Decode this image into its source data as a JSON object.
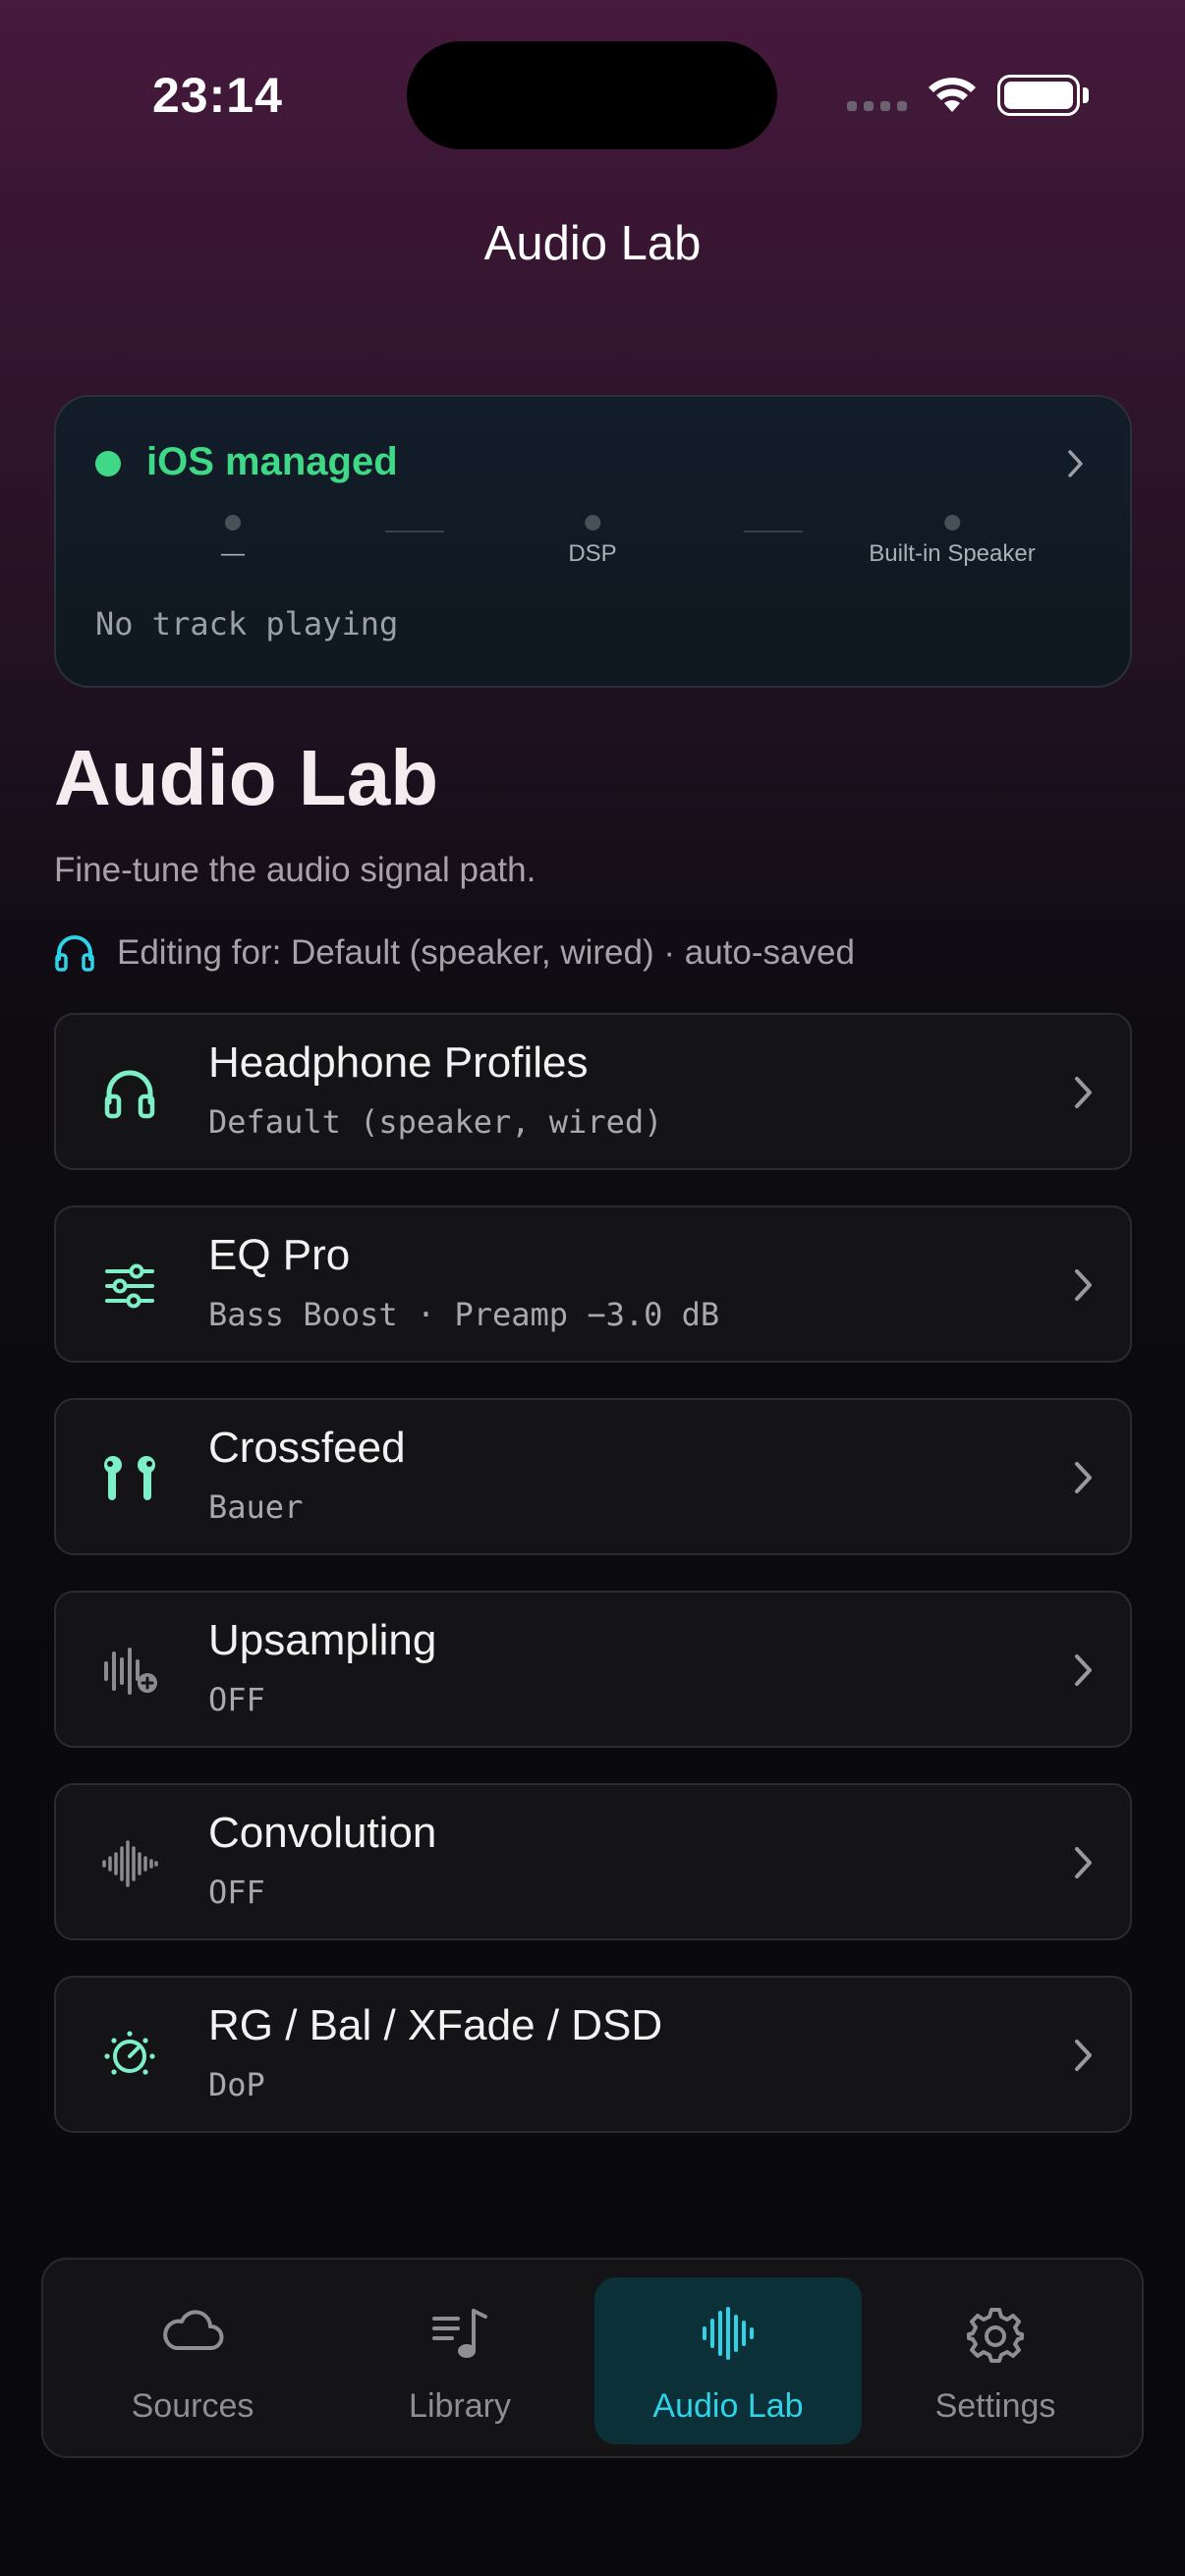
{
  "status_bar": {
    "time": "23:14"
  },
  "nav": {
    "title": "Audio Lab"
  },
  "status_card": {
    "state": "iOS managed",
    "state_color": "#3fd886",
    "chain": [
      "—",
      "DSP",
      "Built-in Speaker"
    ],
    "now_playing": "No track playing"
  },
  "header": {
    "title": "Audio Lab",
    "subtitle": "Fine-tune the audio signal path.",
    "editing": "Editing for: Default (speaker, wired) · auto-saved"
  },
  "items": [
    {
      "title": "Headphone Profiles",
      "value": "Default (speaker, wired)",
      "icon": "headphones-icon"
    },
    {
      "title": "EQ Pro",
      "value": "Bass Boost · Preamp −3.0 dB",
      "icon": "sliders-icon"
    },
    {
      "title": "Crossfeed",
      "value": "Bauer",
      "icon": "earbuds-icon"
    },
    {
      "title": "Upsampling",
      "value": "OFF",
      "icon": "waveform-plus-icon"
    },
    {
      "title": "Convolution",
      "value": "OFF",
      "icon": "waveform-icon"
    },
    {
      "title": "RG / Bal / XFade / DSD",
      "value": "DoP",
      "icon": "dial-icon"
    }
  ],
  "tabs": [
    {
      "label": "Sources",
      "icon": "cloud-icon",
      "active": false
    },
    {
      "label": "Library",
      "icon": "music-list-icon",
      "active": false
    },
    {
      "label": "Audio Lab",
      "icon": "waveform-icon",
      "active": true
    },
    {
      "label": "Settings",
      "icon": "gear-icon",
      "active": false
    }
  ],
  "colors": {
    "accent": "#2fd2e6",
    "icon_mint": "#7ef0c8",
    "icon_gray": "#8c8c90"
  }
}
